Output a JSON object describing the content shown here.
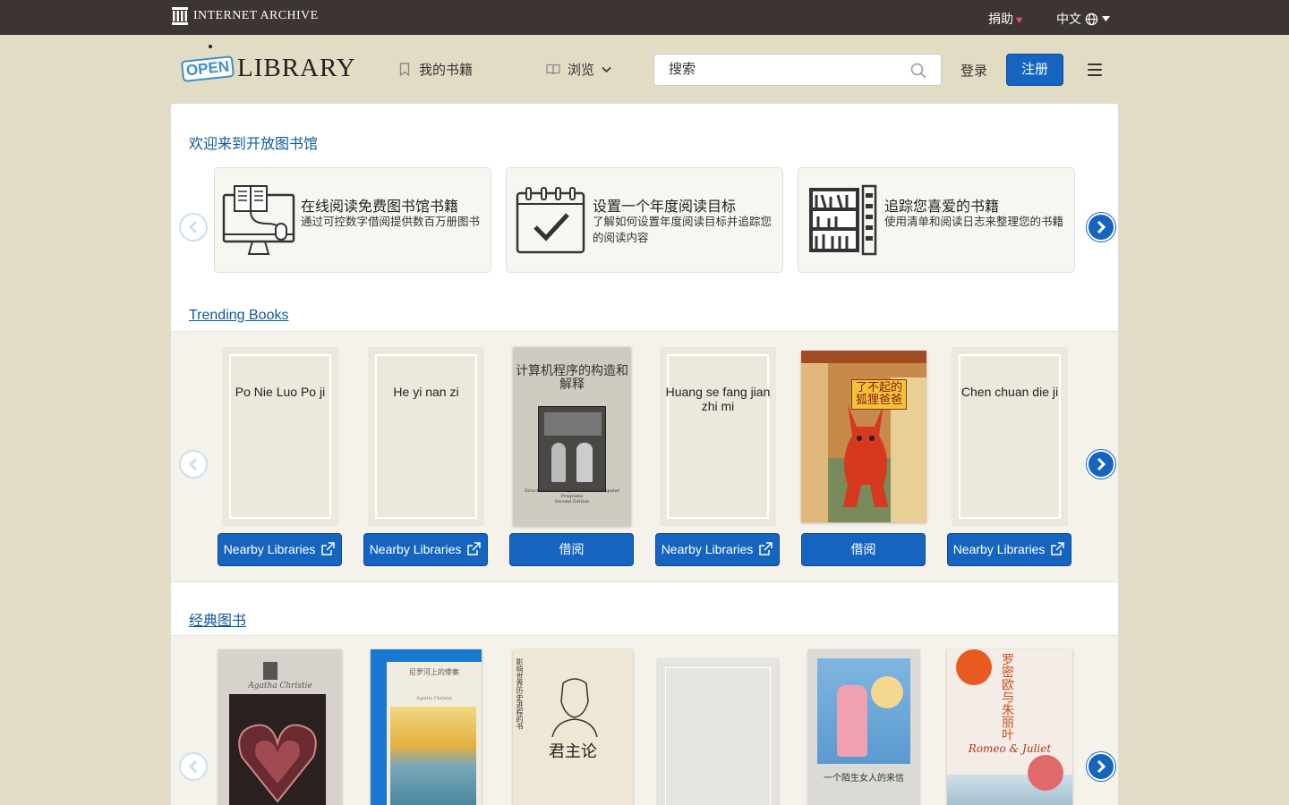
{
  "topbar": {
    "archive_name": "INTERNET ARCHIVE",
    "donate_label": "捐助",
    "donate_heart": "♥",
    "language_label": "中文"
  },
  "header": {
    "logo_open": "OPEN",
    "logo_library": "LIBRARY",
    "my_books": "我的书籍",
    "browse": "浏览",
    "search_placeholder": "搜索",
    "login": "登录",
    "signup": "注册"
  },
  "welcome": {
    "title": "欢迎来到开放图书馆",
    "cards": [
      {
        "title": "在线阅读免费图书馆书籍",
        "desc": "通过可控数字借阅提供数百万册图书",
        "icon": "computer-reading-icon"
      },
      {
        "title": "设置一个年度阅读目标",
        "desc": "了解如何设置年度阅读目标并追踪您的阅读内容",
        "icon": "calendar-check-icon"
      },
      {
        "title": "追踪您喜爱的书籍",
        "desc": "使用清单和阅读日志来整理您的书籍",
        "icon": "bookshelf-icon"
      }
    ]
  },
  "trending": {
    "title": "Trending Books",
    "books": [
      {
        "title": "Po Nie Luo Po ji",
        "button": "Nearby Libraries",
        "has_cover": false
      },
      {
        "title": "He yi nan zi",
        "button": "Nearby Libraries",
        "has_cover": false
      },
      {
        "cover_title": "计算机程序的构造和解释",
        "cover_subtitle": "Structure and Interpretation of Computer Programs",
        "cover_edition": "Second Edition",
        "button": "借阅",
        "has_cover": true
      },
      {
        "title": "Huang se fang jian zhi mi",
        "button": "Nearby Libraries",
        "has_cover": false
      },
      {
        "cover_title": "了不起的狐狸爸爸",
        "button": "借阅",
        "has_cover": true
      },
      {
        "title": "Chen chuan die ji",
        "button": "Nearby Libraries",
        "has_cover": false
      }
    ]
  },
  "classics": {
    "title": "经典图书",
    "books": [
      {
        "cover_text": "Agatha Christie"
      },
      {
        "cover_text": "尼罗河上的惨案",
        "cover_author": "Agatha Christie"
      },
      {
        "cover_text": "君主论",
        "cover_side": "影响世界历史进程的书"
      },
      {
        "cover_text": ""
      },
      {
        "cover_text": "一个陌生女人的来信"
      },
      {
        "cover_text": "罗密欧与朱丽叶",
        "cover_script": "Romeo & Juliet"
      }
    ]
  },
  "colors": {
    "topbar_bg": "#3c3532",
    "page_bg": "#e2dcc5",
    "primary_blue": "#1565c0",
    "link_blue": "#0d5aa0"
  }
}
